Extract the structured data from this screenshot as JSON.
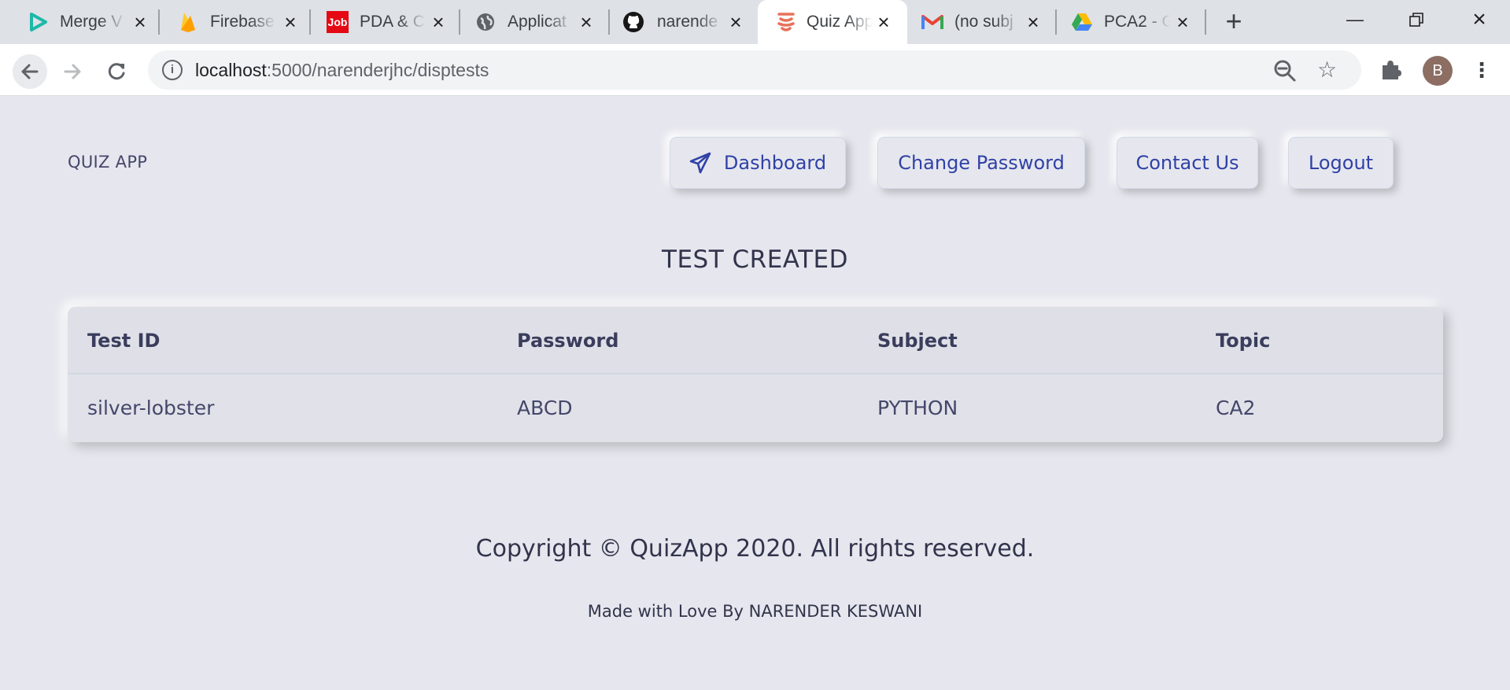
{
  "browser": {
    "tabs": [
      {
        "title": "Merge V",
        "icon": "play-icon",
        "active": false
      },
      {
        "title": "Firebase",
        "icon": "firebase-icon",
        "active": false
      },
      {
        "title": "PDA & C",
        "icon": "job-icon",
        "icon_text": "Job",
        "active": false
      },
      {
        "title": "Applicat",
        "icon": "globe-icon",
        "active": false
      },
      {
        "title": "narende",
        "icon": "github-icon",
        "active": false
      },
      {
        "title": "Quiz App",
        "icon": "quiz-app-icon",
        "active": true
      },
      {
        "title": "(no subj",
        "icon": "gmail-icon",
        "active": false
      },
      {
        "title": "PCA2 - G",
        "icon": "drive-icon",
        "active": false
      }
    ],
    "url_host": "localhost",
    "url_path": ":5000/narenderjhc/disptests",
    "avatar_letter": "B"
  },
  "navbar": {
    "brand": "QUIZ APP",
    "buttons": [
      "Dashboard",
      "Change Password",
      "Contact Us",
      "Logout"
    ]
  },
  "heading": "TEST CREATED",
  "table": {
    "headers": [
      "Test ID",
      "Password",
      "Subject",
      "Topic"
    ],
    "rows": [
      [
        "silver-lobster",
        "ABCD",
        "PYTHON",
        "CA2"
      ]
    ]
  },
  "footer": {
    "copyright": "Copyright © QuizApp 2020. All rights reserved.",
    "made_by": "Made with Love By NARENDER KESWANI"
  }
}
